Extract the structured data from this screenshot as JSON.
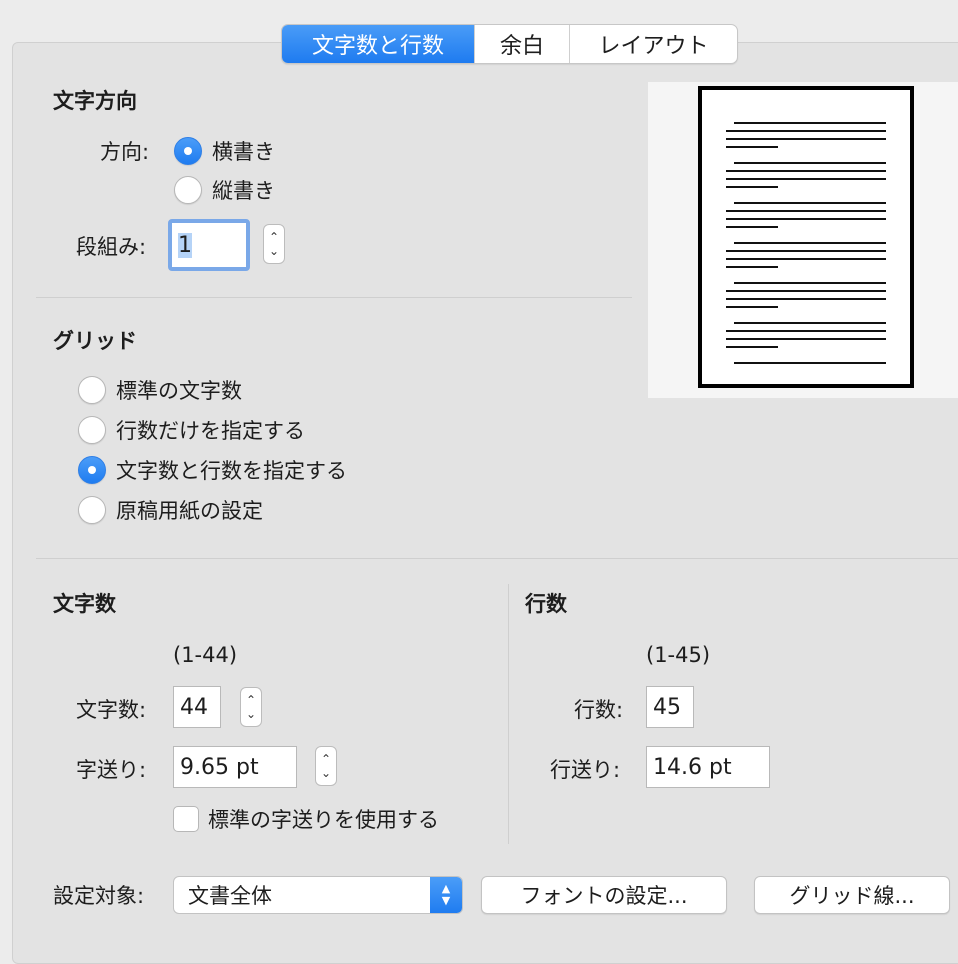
{
  "tabs": [
    {
      "label": "文字数と行数",
      "active": true
    },
    {
      "label": "余白",
      "active": false
    },
    {
      "label": "レイアウト",
      "active": false
    }
  ],
  "direction_section": {
    "title": "文字方向",
    "direction_label": "方向:",
    "options": [
      {
        "label": "横書き",
        "selected": true
      },
      {
        "label": "縦書き",
        "selected": false
      }
    ],
    "columns_label": "段組み:",
    "columns_value": "1"
  },
  "grid_section": {
    "title": "グリッド",
    "options": [
      {
        "label": "標準の文字数",
        "selected": false
      },
      {
        "label": "行数だけを指定する",
        "selected": false
      },
      {
        "label": "文字数と行数を指定する",
        "selected": true
      },
      {
        "label": "原稿用紙の設定",
        "selected": false
      }
    ]
  },
  "chars_section": {
    "title": "文字数",
    "range": "(1-44)",
    "count_label": "文字数:",
    "count_value": "44",
    "pitch_label": "字送り:",
    "pitch_value": "9.65 pt",
    "use_default_label": "標準の字送りを使用する",
    "use_default_checked": false
  },
  "lines_section": {
    "title": "行数",
    "range": "(1-45)",
    "count_label": "行数:",
    "count_value": "45",
    "pitch_label": "行送り:",
    "pitch_value": "14.6 pt"
  },
  "footer": {
    "apply_to_label": "設定対象:",
    "apply_to_value": "文書全体",
    "font_button": "フォントの設定...",
    "gridlines_button": "グリッド線..."
  },
  "colors": {
    "accent": "#1e7bf0"
  }
}
